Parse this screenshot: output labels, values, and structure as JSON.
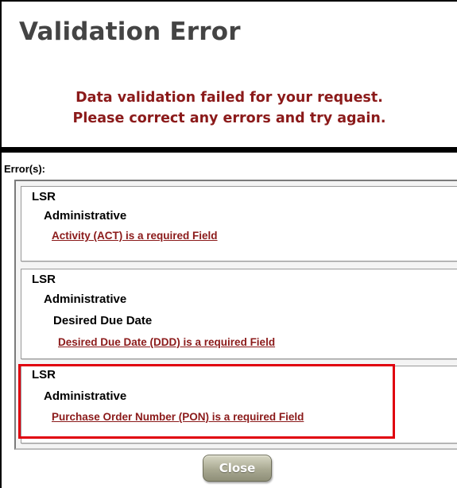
{
  "dialog": {
    "title": "Validation Error",
    "message_line1": "Data validation failed for your request.",
    "message_line2": "Please correct any errors and try again."
  },
  "errors_label": "Error(s):",
  "errors": [
    {
      "form": "LSR",
      "section": "Administrative",
      "subsection": "",
      "message": "Activity (ACT) is a required Field"
    },
    {
      "form": "LSR",
      "section": "Administrative",
      "subsection": "Desired Due Date",
      "message": "Desired Due Date (DDD) is a required Field"
    },
    {
      "form": "LSR",
      "section": "Administrative",
      "subsection": "",
      "message": "Purchase Order Number (PON) is a required Field"
    }
  ],
  "close_label": "Close",
  "colors": {
    "error_text": "#8b1a1a",
    "title_text": "#444444",
    "highlight_border": "#e0000e",
    "button_face": "#a9a992"
  }
}
